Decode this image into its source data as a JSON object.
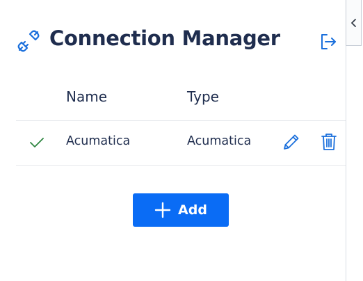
{
  "header": {
    "title": "Connection Manager",
    "icon": "plug-connection-icon",
    "exit_icon": "sign-out-icon"
  },
  "table": {
    "columns": [
      "Name",
      "Type"
    ],
    "rows": [
      {
        "selected": true,
        "name": "Acumatica",
        "type": "Acumatica"
      }
    ]
  },
  "add_button": {
    "label": "Add",
    "icon": "plus-icon"
  },
  "collapse_button": {
    "icon": "chevron-left-icon"
  },
  "colors": {
    "primary": "#0a6cf5",
    "title": "#1f2d4e",
    "check": "#2e8540",
    "icon_blue": "#1a6fdc"
  }
}
